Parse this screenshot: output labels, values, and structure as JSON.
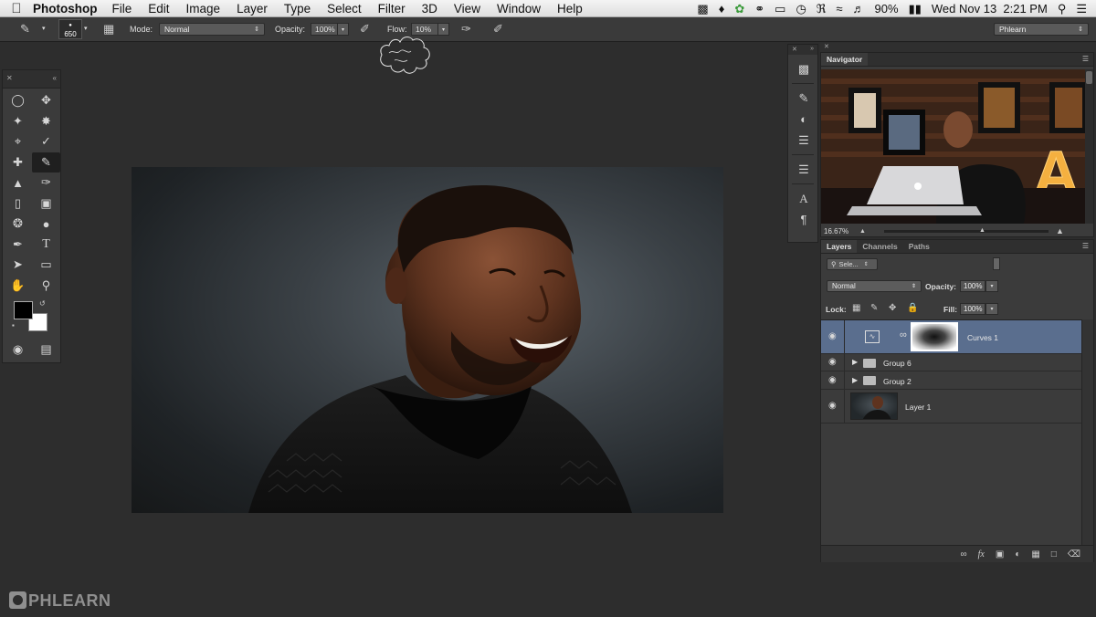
{
  "menubar": {
    "app_name": "Photoshop",
    "menus": [
      "File",
      "Edit",
      "Image",
      "Layer",
      "Type",
      "Select",
      "Filter",
      "3D",
      "View",
      "Window",
      "Help"
    ],
    "battery": "90%",
    "datetime": "Wed Nov 13  2:21 PM"
  },
  "options_bar": {
    "brush_size": "650",
    "mode_label": "Mode:",
    "mode_value": "Normal",
    "opacity_label": "Opacity:",
    "opacity_value": "100%",
    "flow_label": "Flow:",
    "flow_value": "10%",
    "workspace": "Phlearn"
  },
  "navigator": {
    "tab": "Navigator",
    "zoom": "16.67%"
  },
  "layers_panel": {
    "tabs": [
      "Layers",
      "Channels",
      "Paths"
    ],
    "kind_filter": "Sele...",
    "blend_mode": "Normal",
    "opacity_label": "Opacity:",
    "opacity_value": "100%",
    "lock_label": "Lock:",
    "fill_label": "Fill:",
    "fill_value": "100%",
    "layers": [
      {
        "name": "Curves 1",
        "type": "adjustment",
        "selected": true
      },
      {
        "name": "Group 6",
        "type": "group",
        "selected": false
      },
      {
        "name": "Group 2",
        "type": "group",
        "selected": false
      },
      {
        "name": "Layer 1",
        "type": "pixel",
        "selected": false
      }
    ]
  },
  "watermark": "PHLEARN",
  "colors": {
    "foreground": "#000000",
    "background": "#ffffff",
    "selected_layer": "#5a6e8e"
  }
}
